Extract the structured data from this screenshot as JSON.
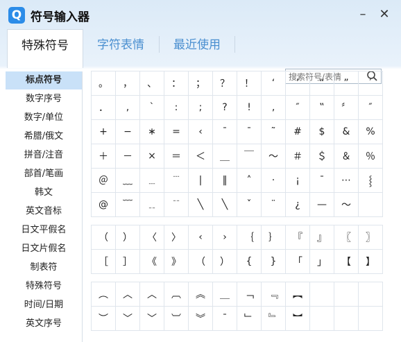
{
  "window": {
    "logo": "Q",
    "title": "符号输入器",
    "minimize": "–",
    "close": "✕"
  },
  "tabs": [
    {
      "label": "特殊符号"
    },
    {
      "label": "字符表情"
    },
    {
      "label": "最近使用"
    }
  ],
  "search": {
    "placeholder": "搜索符号/表情",
    "icon": "search-icon"
  },
  "sidebar": {
    "items": [
      {
        "label": "标点符号"
      },
      {
        "label": "数字序号"
      },
      {
        "label": "数字/单位"
      },
      {
        "label": "希腊/俄文"
      },
      {
        "label": "拼音/注音"
      },
      {
        "label": "部首/笔画"
      },
      {
        "label": "韩文"
      },
      {
        "label": "英文音标"
      },
      {
        "label": "日文平假名"
      },
      {
        "label": "日文片假名"
      },
      {
        "label": "制表符"
      },
      {
        "label": "特殊符号"
      },
      {
        "label": "时间/日期"
      },
      {
        "label": "英文序号"
      }
    ]
  },
  "grids": [
    {
      "rows": [
        [
          "。",
          "，",
          "、",
          "：",
          "；",
          "？",
          "！",
          "‘",
          "’",
          "“",
          "”",
          "′"
        ],
        [
          "．",
          ",",
          "ˋ",
          ":",
          ";",
          "?",
          "!",
          "‚",
          "″",
          "‟",
          "〞",
          "″"
        ],
        [
          "+",
          "−",
          "∗",
          "=",
          "‹",
          "ˉ",
          "¯",
          "˜",
          "#",
          "$",
          "&",
          "%"
        ],
        [
          "＋",
          "－",
          "×",
          "＝",
          "＜",
          "＿",
          "￣",
          "～",
          "＃",
          "＄",
          "＆",
          "％"
        ],
        [
          "＠",
          "﹏",
          "﹍",
          "﹉",
          "|",
          "‖",
          "˄",
          "·",
          "¡",
          "ˉ",
          "⋯",
          "⸾"
        ],
        [
          "@",
          "﹋",
          "﹎",
          "﹊",
          "╲",
          "╲",
          "ˇ",
          "¨",
          "¿",
          "—",
          "～",
          ""
        ]
      ]
    },
    {
      "rows": [
        [
          "（",
          "）",
          "〈",
          "〉",
          "‹",
          "›",
          "｛",
          "｝",
          "『",
          "』",
          "〖",
          "〗"
        ],
        [
          "［",
          "］",
          "《",
          "》",
          "（",
          "）",
          "{",
          "}",
          "「",
          "」",
          "【",
          "】"
        ]
      ]
    },
    {
      "rows": [
        [
          "︵",
          "︿",
          "︿",
          "︹",
          "︽",
          "＿",
          "﹁",
          "﹃",
          "︻",
          "",
          "",
          ""
        ],
        [
          "︶",
          "﹀",
          "﹀",
          "︺",
          "︾",
          "ˉ",
          "﹂",
          "﹄",
          "︼",
          "",
          "",
          ""
        ]
      ]
    }
  ]
}
